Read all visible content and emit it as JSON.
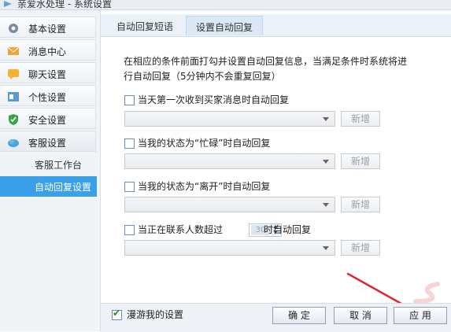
{
  "window": {
    "title": "亲爱水处理 - 系统设置"
  },
  "sidebar": {
    "items": [
      {
        "label": "基本设置",
        "icon": "gear-icon"
      },
      {
        "label": "消息中心",
        "icon": "envelope-icon"
      },
      {
        "label": "聊天设置",
        "icon": "chat-icon"
      },
      {
        "label": "个性设置",
        "icon": "profile-icon"
      },
      {
        "label": "安全设置",
        "icon": "shield-icon"
      },
      {
        "label": "客服设置",
        "icon": "cloud-icon"
      }
    ],
    "subitems": [
      {
        "label": "客服工作台"
      },
      {
        "label": "自动回复设置"
      }
    ]
  },
  "tabs": [
    {
      "label": "自动回复短语"
    },
    {
      "label": "设置自动回复"
    }
  ],
  "main": {
    "description": "在相应的条件前面打勾并设置自动回复信息，当满足条件时系统将进行自动回复（5分钟内不会重复回复）",
    "options": [
      {
        "label": "当天第一次收到买家消息时自动回复",
        "checked": false
      },
      {
        "label": "当我的状态为“忙碌”时自动回复",
        "checked": false
      },
      {
        "label": "当我的状态为“离开”时自动回复",
        "checked": false
      },
      {
        "label_prefix": "当正在联系人数超过",
        "spin_value": "30",
        "label_suffix": "时自动回复",
        "checked": false
      }
    ],
    "add_label": "新增"
  },
  "footer": {
    "roam_label": "漫游我的设置",
    "roam_checked": true,
    "ok": "确 定",
    "cancel": "取 消",
    "apply": "应 用"
  },
  "colors": {
    "accent": "#3aa0e8",
    "annotation_arrow": "#e0262a"
  }
}
